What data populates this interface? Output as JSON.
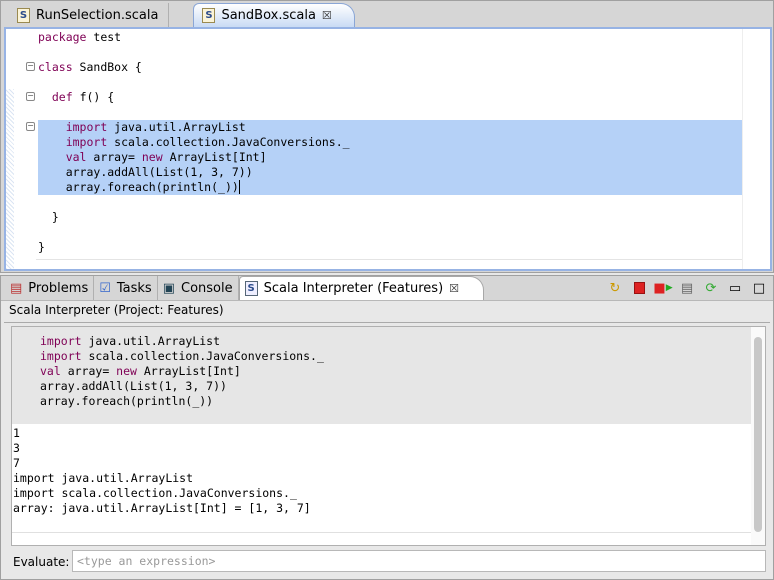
{
  "editor_tabs": [
    {
      "label": "RunSelection.scala",
      "active": false
    },
    {
      "label": "SandBox.scala",
      "active": true
    }
  ],
  "editor": {
    "lines": [
      {
        "kw": "package",
        "rest": " test",
        "indent": ""
      },
      {
        "kw": "class",
        "rest": " SandBox {",
        "indent": ""
      },
      {
        "kw": "def",
        "rest": " f() {",
        "indent": "  "
      },
      {
        "kw": "import",
        "rest": " java.util.ArrayList",
        "indent": "    "
      },
      {
        "kw": "import",
        "rest": " scala.collection.JavaConversions._",
        "indent": "    "
      },
      {
        "kw": "val",
        "rest": " array= ",
        "kw2": "new",
        "rest2": " ArrayList[Int]",
        "indent": "    "
      },
      {
        "kw": "",
        "rest": "array.addAll(List(1, 3, 7))",
        "indent": "    "
      },
      {
        "kw": "",
        "rest": "array.foreach(println(_))",
        "indent": "    "
      },
      {
        "kw": "",
        "rest": "}",
        "indent": "  "
      },
      {
        "kw": "",
        "rest": "}",
        "indent": ""
      }
    ]
  },
  "bottom_tabs": [
    {
      "label": "Problems"
    },
    {
      "label": "Tasks"
    },
    {
      "label": "Console"
    },
    {
      "label": "Scala Interpreter (Features)",
      "active": true
    }
  ],
  "panel_title": "Scala Interpreter (Project: Features)",
  "console": {
    "input": [
      {
        "kw": "import",
        "rest": " java.util.ArrayList"
      },
      {
        "kw": "import",
        "rest": " scala.collection.JavaConversions._"
      },
      {
        "kw": "val",
        "rest": " array= ",
        "kw2": "new",
        "rest2": " ArrayList[Int]"
      },
      {
        "kw": "",
        "rest": "array.addAll(List(1, 3, 7))"
      },
      {
        "kw": "",
        "rest": "array.foreach(println(_))"
      }
    ],
    "output": [
      "1",
      "3",
      "7",
      "import java.util.ArrayList",
      "import scala.collection.JavaConversions._",
      "array: java.util.ArrayList[Int] = [1, 3, 7]"
    ]
  },
  "evaluate": {
    "label": "Evaluate:",
    "placeholder": "<type an expression>"
  }
}
